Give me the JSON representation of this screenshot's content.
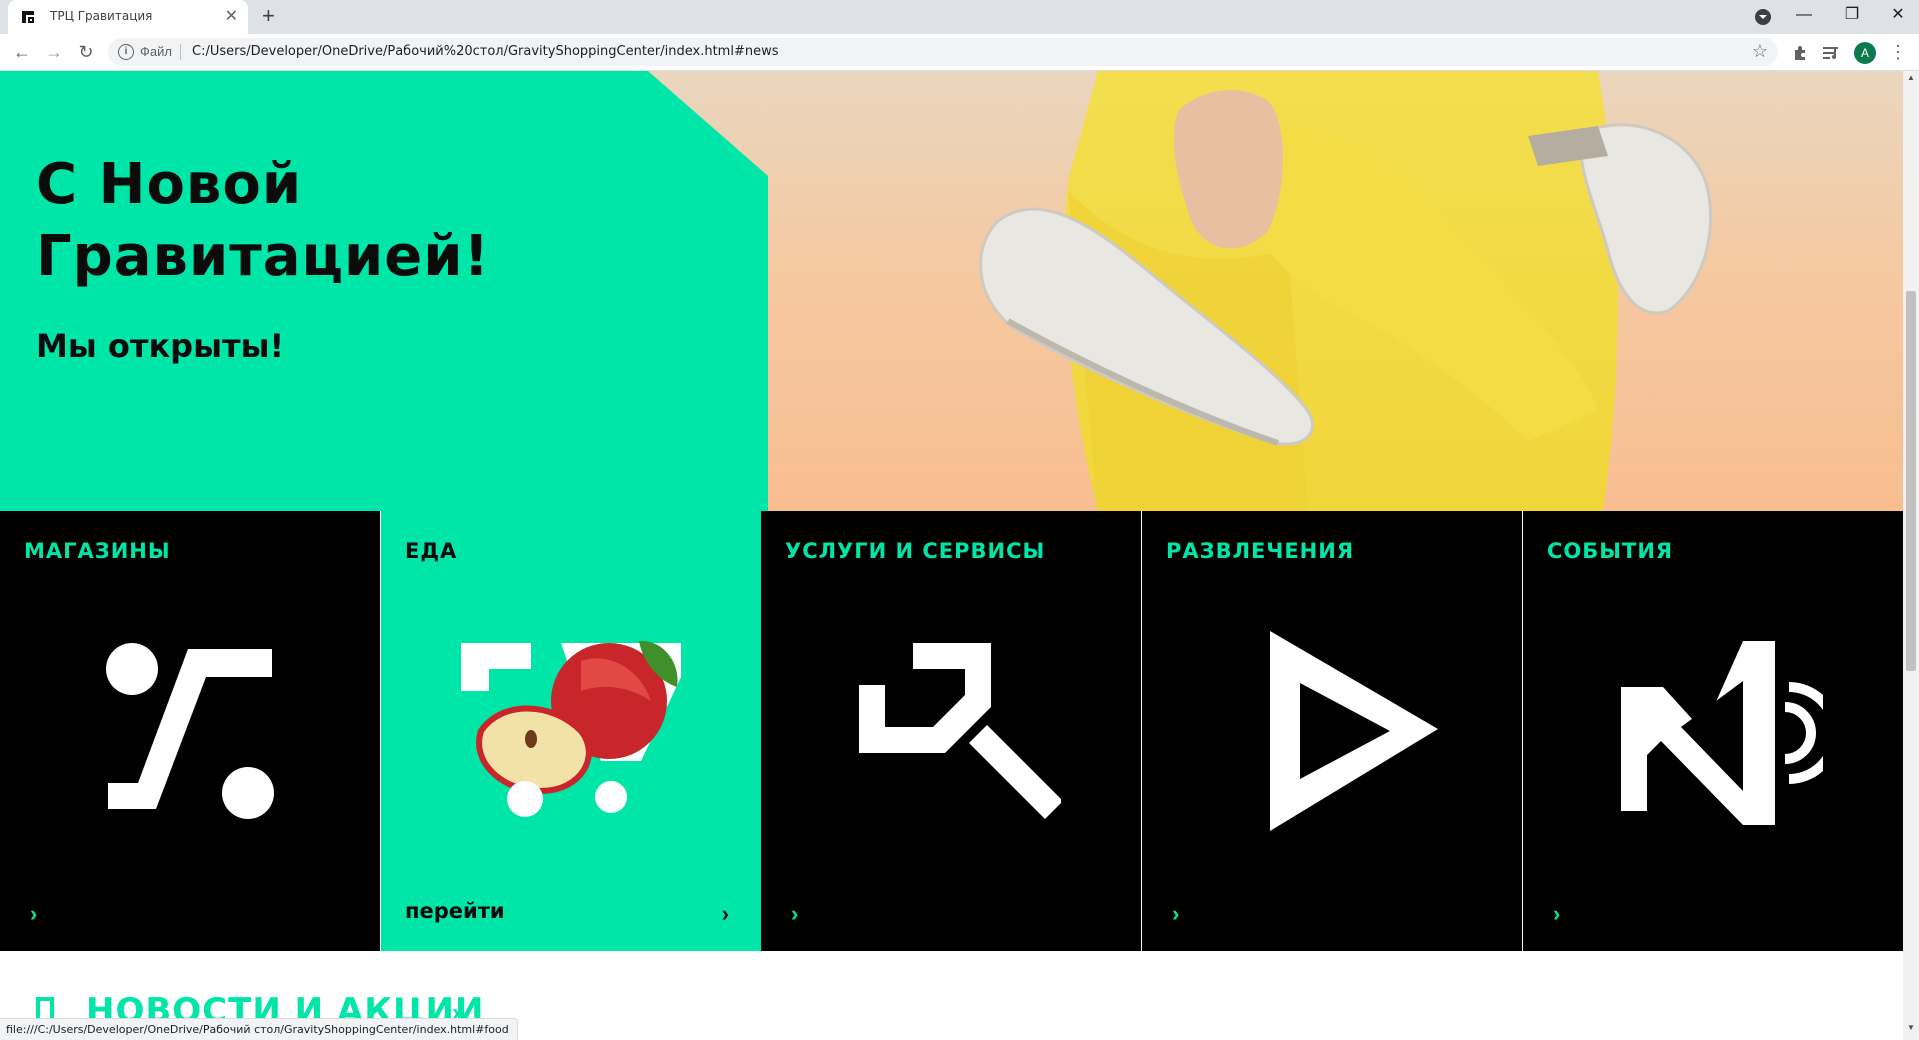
{
  "browser": {
    "tab_title": "ТРЦ Гравитация",
    "tab_close": "✕",
    "new_tab": "+",
    "scheme_label": "Файл",
    "url": "C:/Users/Developer/OneDrive/Рабочий%20стол/GravityShoppingCenter/index.html#news",
    "avatar_letter": "A",
    "status_url": "file:///C:/Users/Developer/OneDrive/Рабочий стол/GravityShoppingCenter/index.html#food"
  },
  "hero": {
    "title": "С Новой Гравитацией!",
    "subtitle": "Мы открыты!"
  },
  "categories": [
    {
      "title": "МАГАЗИНЫ",
      "icon": "percent-icon"
    },
    {
      "title": "ЕДА",
      "icon": "cart-apple-icon",
      "link": "перейти"
    },
    {
      "title": "УСЛУГИ И СЕРВИСЫ",
      "icon": "hammer-icon"
    },
    {
      "title": "РАЗВЛЕЧЕНИЯ",
      "icon": "play-icon"
    },
    {
      "title": "СОБЫТИЯ",
      "icon": "megaphone-icon"
    }
  ],
  "news": {
    "title": "НОВОСТИ И АКЦИИ"
  },
  "colors": {
    "accent": "#00e5a8",
    "dark": "#000000"
  }
}
